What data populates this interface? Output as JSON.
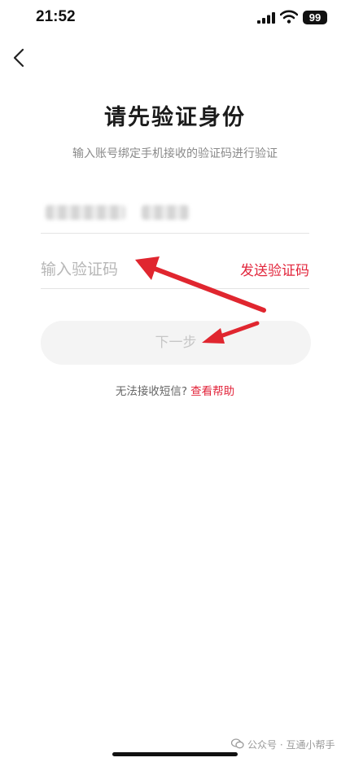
{
  "status_bar": {
    "time": "21:52",
    "battery": "99"
  },
  "page": {
    "title": "请先验证身份",
    "subtitle": "输入账号绑定手机接收的验证码进行验证"
  },
  "form": {
    "code_placeholder": "输入验证码",
    "send_code_label": "发送验证码",
    "next_button_label": "下一步"
  },
  "help": {
    "prompt": "无法接收短信?",
    "link_label": "查看帮助"
  },
  "watermark": {
    "text": "公众号 · 互通小帮手"
  },
  "colors": {
    "accent": "#e2263c",
    "arrow": "#e0262f",
    "disabled_button_bg": "#f4f4f4",
    "disabled_button_text": "#c6c6c6"
  },
  "icons": {
    "back": "chevron-left-icon",
    "signal": "cellular-signal-icon",
    "wifi": "wifi-icon",
    "watermark": "wechat-icon"
  }
}
